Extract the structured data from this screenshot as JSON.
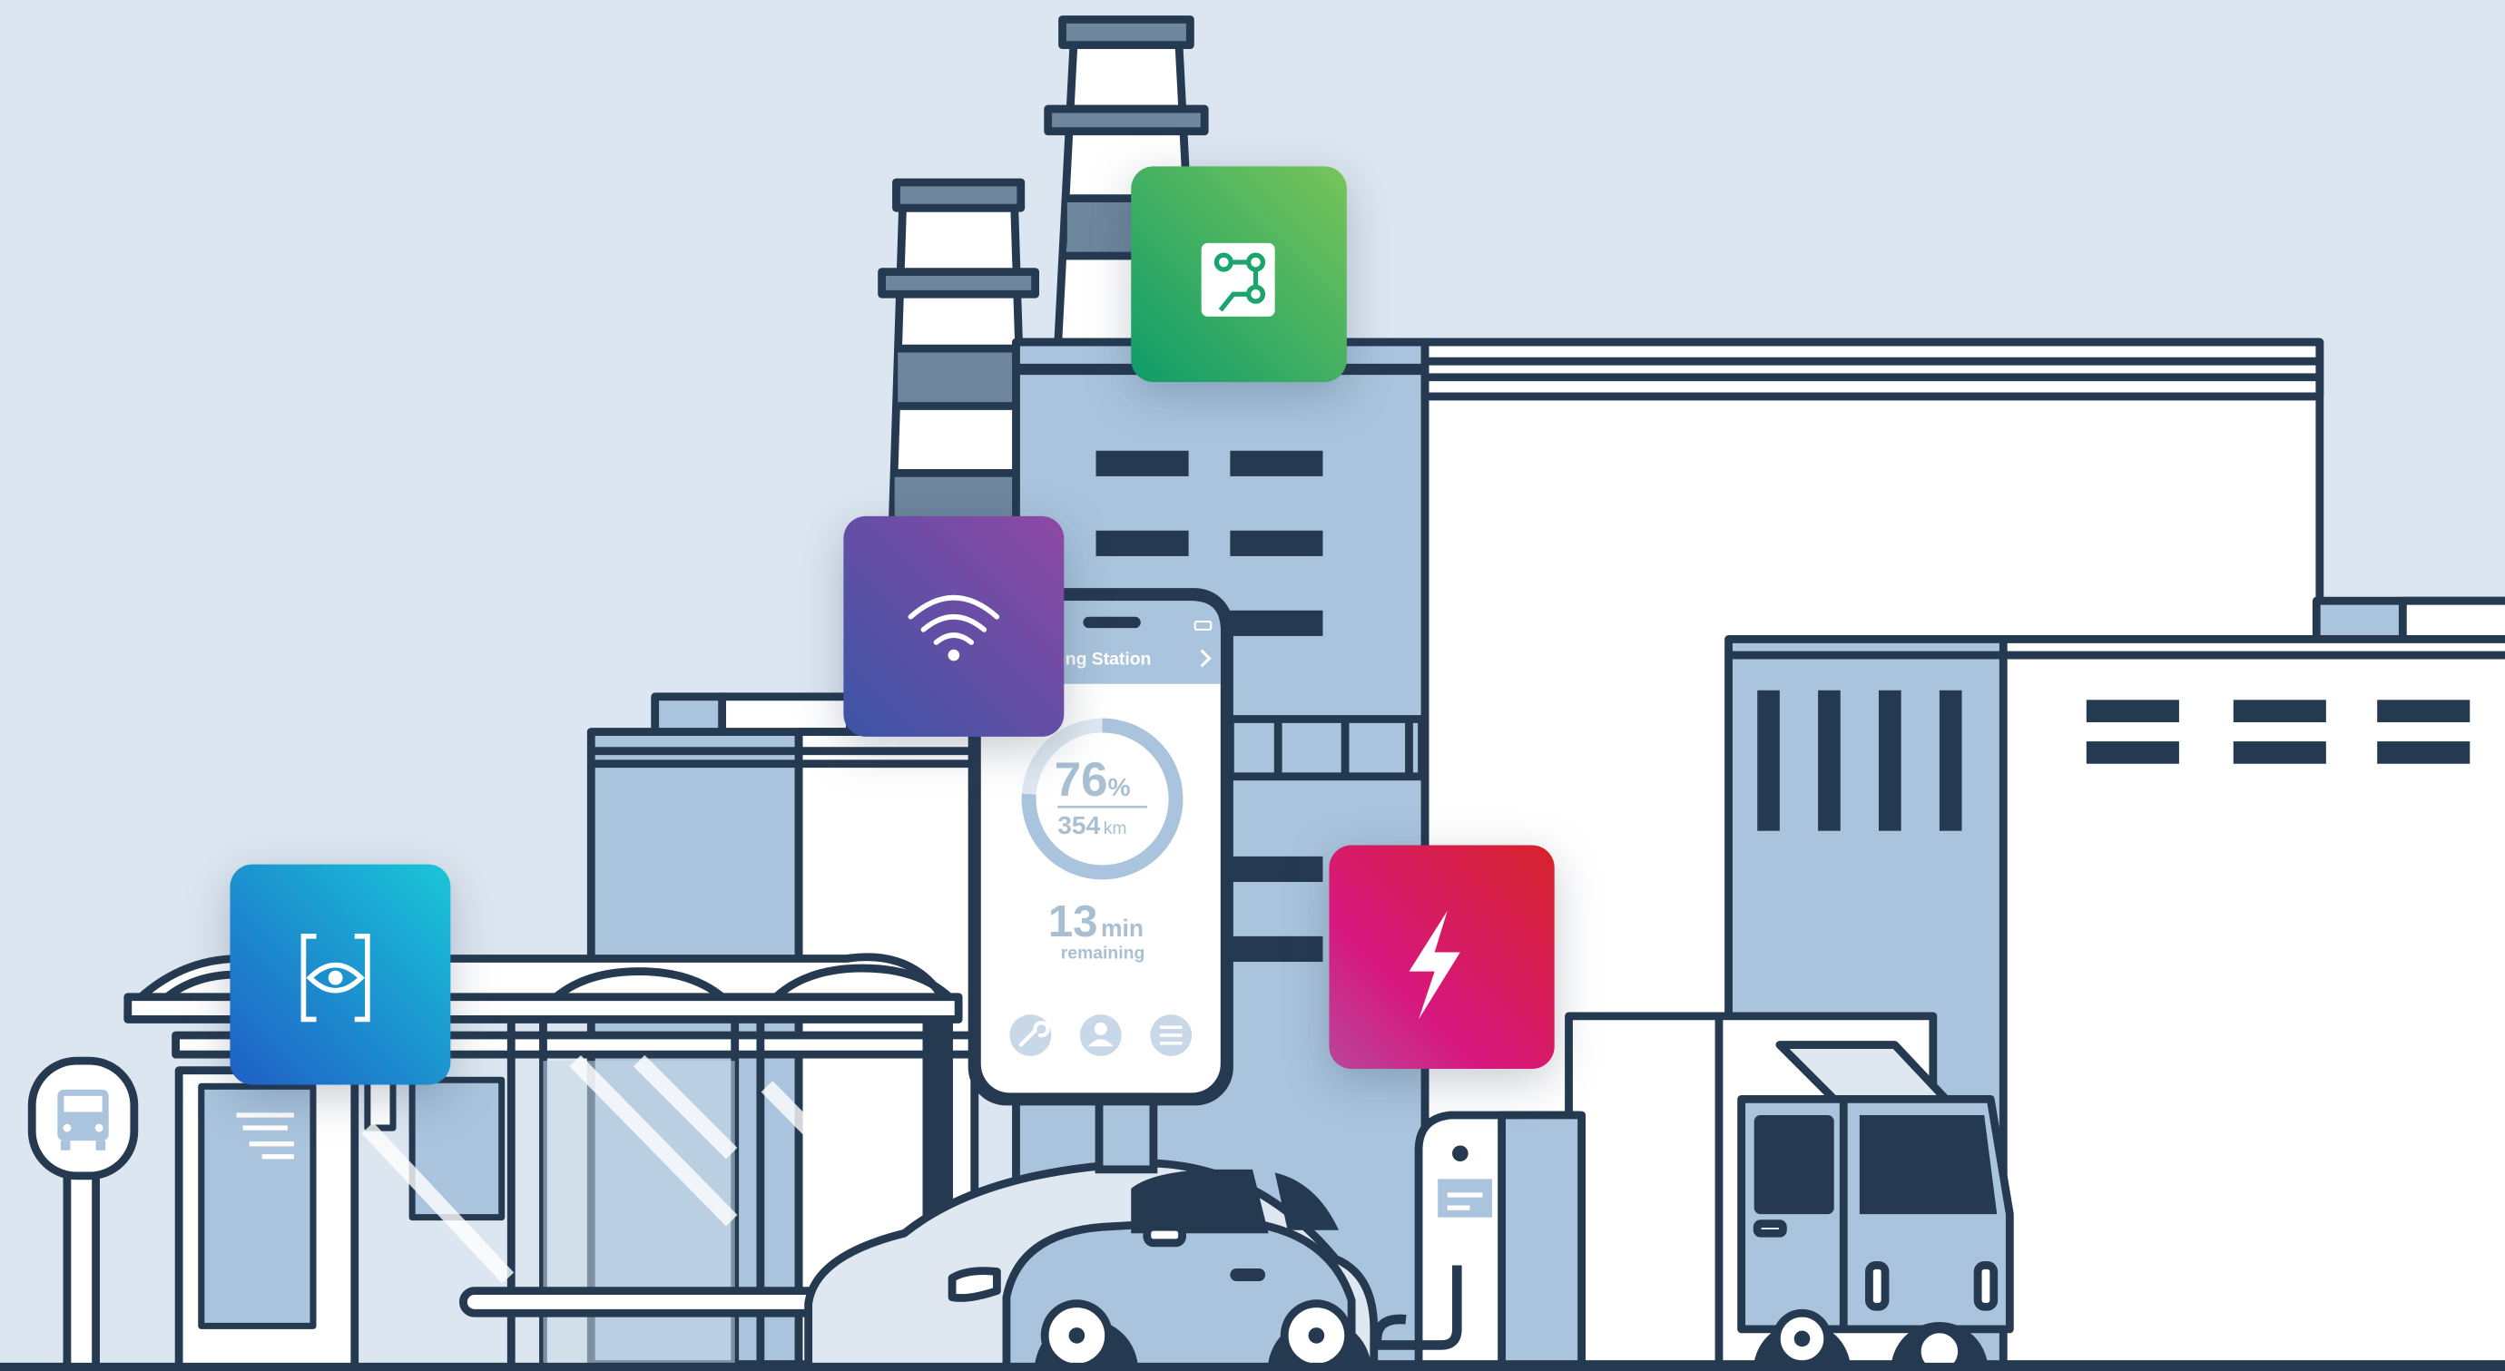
{
  "phone": {
    "header": "Charging Station",
    "battery_percent_value": "76",
    "battery_percent_unit": "%",
    "range_value": "354",
    "range_unit": "km",
    "time_value": "13",
    "time_unit": "min",
    "time_caption": "remaining",
    "charge_level_percent": 76
  },
  "icons": {
    "bus_stop_sign": "bus-icon",
    "tile_blue": "eye-scan-icon",
    "tile_purple": "wifi-icon",
    "tile_green": "circuit-route-icon",
    "tile_red": "lightning-bolt-icon",
    "phone_nav": [
      "wrench-icon",
      "user-icon",
      "list-icon"
    ]
  },
  "colors": {
    "background": "#dce6f0",
    "outline": "#253a50",
    "building_fill": "#a9c4dc",
    "tile_blue": [
      "#1f63c8",
      "#18c3d8"
    ],
    "tile_purple": [
      "#3c55a8",
      "#8a4aa6"
    ],
    "tile_green": [
      "#0f9f6a",
      "#74c35a"
    ],
    "tile_red": [
      "#d2177e",
      "#d5202a"
    ]
  }
}
